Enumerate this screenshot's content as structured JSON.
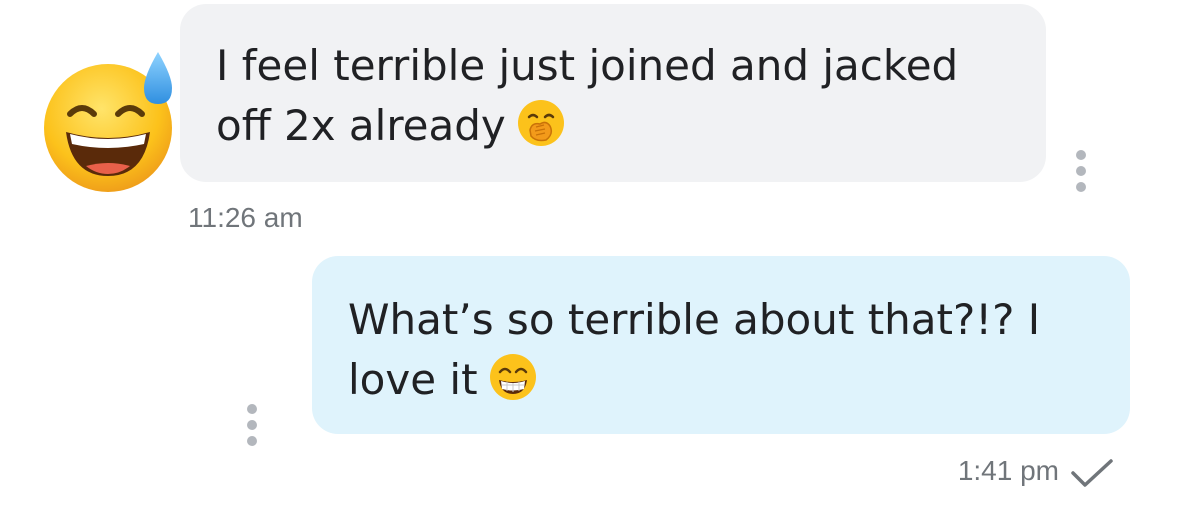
{
  "messages": [
    {
      "direction": "incoming",
      "text": "I feel terrible just joined and jacked off 2x already",
      "emoji": "face-with-hand-over-mouth",
      "time": "11:26 am",
      "avatar": "grinning-face-with-sweat"
    },
    {
      "direction": "outgoing",
      "text": "What’s so terrible about that?!? I love it",
      "emoji": "beaming-face-with-smiling-eyes",
      "time": "1:41 pm",
      "status_icon": "checkmark-icon"
    }
  ],
  "colors": {
    "incoming_bubble": "#f1f2f4",
    "outgoing_bubble": "#dff3fc",
    "text": "#202124",
    "timestamp": "#70757a",
    "dots": "#b3b7bd"
  }
}
